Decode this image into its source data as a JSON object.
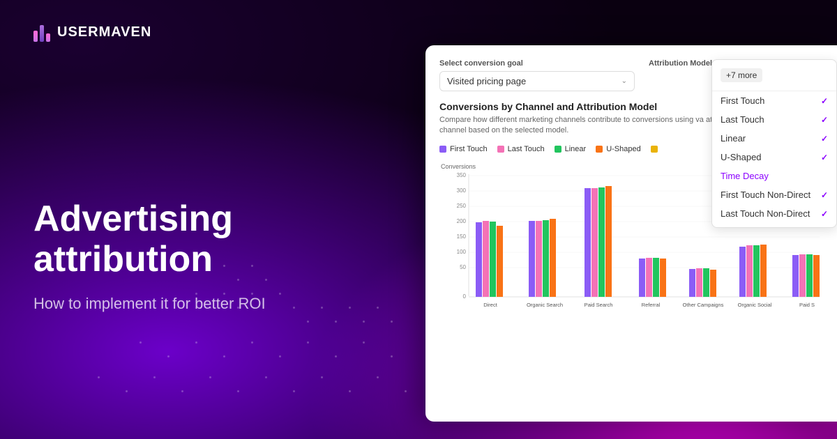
{
  "brand": {
    "name": "USERMAVEN"
  },
  "header": {
    "title": "Advertising attribution",
    "subtitle": "How to implement it for better ROI"
  },
  "panel": {
    "conversion_goal_label": "Select conversion goal",
    "conversion_goal_value": "Visited pricing page",
    "attribution_models_label": "Attribution Models",
    "more_btn": "+7 more",
    "models": [
      {
        "label": "First Touch",
        "checked": true
      },
      {
        "label": "Last Touch",
        "checked": true
      },
      {
        "label": "Linear",
        "checked": true
      },
      {
        "label": "U-Shaped",
        "checked": true
      },
      {
        "label": "Time Decay",
        "checked": false,
        "active": true
      },
      {
        "label": "First Touch Non-Direct",
        "checked": true
      },
      {
        "label": "Last Touch Non-Direct",
        "checked": true
      }
    ]
  },
  "chart": {
    "title": "Conversions by Channel and Attribution Model",
    "description": "Compare how different marketing channels contribute to conversions using va attributed to a channel based on the selected model.",
    "y_axis_label": "Conversions",
    "y_ticks": [
      "350",
      "300",
      "250",
      "200",
      "150",
      "100",
      "50",
      "0"
    ],
    "legend": [
      {
        "label": "First Touch",
        "color": "#8b5cf6"
      },
      {
        "label": "Last Touch",
        "color": "#f472b6"
      },
      {
        "label": "Linear",
        "color": "#22c55e"
      },
      {
        "label": "U-Shaped",
        "color": "#f97316"
      },
      {
        "label": "",
        "color": "#eab308"
      }
    ],
    "categories": [
      "Direct",
      "Organic Search",
      "Paid Search",
      "Referral",
      "Other Campaigns",
      "Organic Social",
      "Paid S"
    ],
    "series": {
      "first_touch": [
        215,
        220,
        315,
        110,
        80,
        145,
        120
      ],
      "last_touch": [
        220,
        220,
        315,
        112,
        82,
        148,
        122
      ],
      "linear": [
        218,
        222,
        318,
        112,
        82,
        148,
        122
      ],
      "u_shaped": [
        205,
        225,
        320,
        110,
        78,
        150,
        120
      ],
      "time_decay": [
        0,
        0,
        0,
        0,
        0,
        0,
        0
      ]
    }
  }
}
